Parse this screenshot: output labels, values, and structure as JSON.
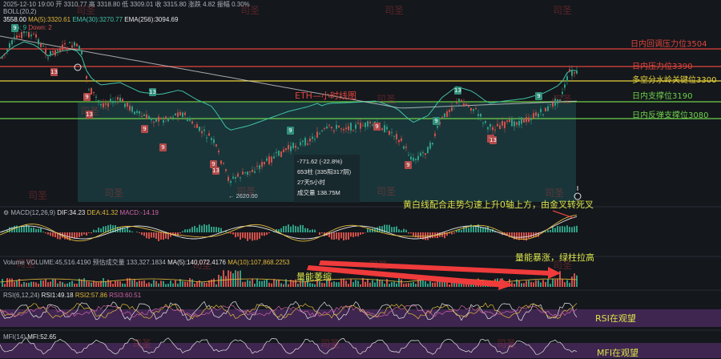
{
  "top_bar": {
    "date_time": "2025-12-10 19:00",
    "ohlc": "开 3310.77  高 3318.80  低 3309.01  收 3315.80  涨跌 4.82  振幅 0.30%"
  },
  "indicators": {
    "boll": "BOLL(20,2)",
    "ma_line": "MA(5):3320.61",
    "ema30": "EMA(30):3270.77",
    "ema256": "EMA(256):3094.69",
    "up_label": "Up: 9",
    "down_label": "Down: 2",
    "price_label": "3558.00",
    "macd_name": "MACD(12,26,9)",
    "dif": "DIF:34.23",
    "dea": "DEA:41.32",
    "macd": "MACD:-14.19",
    "volume_name": "Volume",
    "volume_value": "VOLUME:45,516.4190",
    "volume_est": "预估成交量 133,327.1834",
    "vol_ma5": "MA(5):140,072.4176",
    "vol_ma10": "MA(10):107,868.2253",
    "rsi_name": "RSI(6,12,24)",
    "rsi1": "RSI1:49.18",
    "rsi2": "RSI2:57.86",
    "rsi3": "RSI3:60.51",
    "mfi_name": "MFI(14)",
    "mfi": "MFI:52.65"
  },
  "levels": [
    {
      "label": "日内回调压力位3504",
      "color": "#e0443c"
    },
    {
      "label": "日内压力位3390",
      "color": "#e0443c"
    },
    {
      "label": "多空分水岭关键位3300",
      "color": "#e8d23a"
    },
    {
      "label": "日内支撑位3190",
      "color": "#6ed04a"
    },
    {
      "label": "日内反弹支撑位3080",
      "color": "#6ed04a"
    }
  ],
  "annotations": {
    "chart_title": "ETH—小时线图",
    "macd_note": "黄白线配合走势匀速上升0轴上方，由金叉转死叉",
    "volume_surge": "量能暴涨，绿柱拉高",
    "volume_shrink": "量能萎缩",
    "rsi_note": "RSI在观望",
    "mfi_note": "MFI在观望"
  },
  "tooltip": {
    "change": "-771.62 (-22.8%)",
    "bars": "653柱 (335阳317阴)",
    "duration": "27天5小时",
    "volume": "成交量 138.75M"
  },
  "low_marker": "2620.00",
  "watermark": "司圣",
  "colors": {
    "background": "#14171c",
    "up": "#2f9e84",
    "down": "#d3504a",
    "resistance": "#e0443c",
    "key_level": "#e8d23a",
    "support": "#6ed04a",
    "highlight_box": "#1d4e52",
    "osc_band": "#4a2a5e"
  }
}
